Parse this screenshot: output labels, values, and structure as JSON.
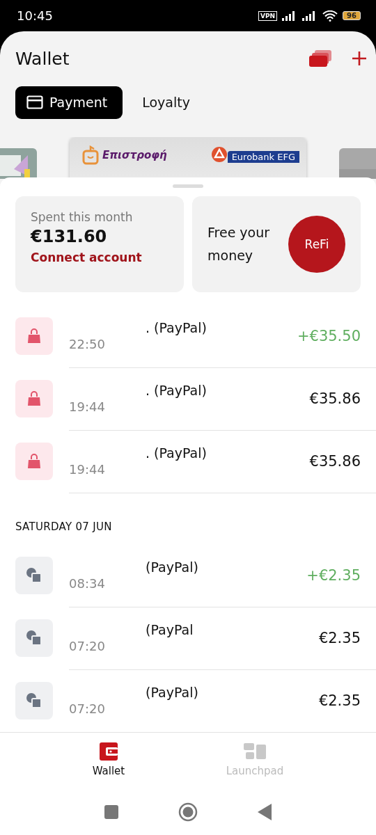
{
  "status_bar": {
    "time": "10:45",
    "vpn": "VPN",
    "battery": "96"
  },
  "header": {
    "title": "Wallet"
  },
  "tabs": [
    {
      "label": "Payment",
      "selected": true
    },
    {
      "label": "Loyalty",
      "selected": false
    }
  ],
  "card": {
    "brand": "Επιστροφή",
    "bank": "Eurobank EFG"
  },
  "summary": {
    "label": "Spent this month",
    "amount": "€131.60",
    "link": "Connect account",
    "promo": "Free your money",
    "promo_button": "ReFi"
  },
  "transactions": [
    {
      "kind": "purchase",
      "name": ". (PayPal)",
      "time": "22:50",
      "amount": "+€35.50",
      "incoming": true
    },
    {
      "kind": "purchase",
      "name": ". (PayPal)",
      "time": "19:44",
      "amount": "€35.86",
      "incoming": false
    },
    {
      "kind": "purchase",
      "name": ". (PayPal)",
      "time": "19:44",
      "amount": "€35.86",
      "incoming": false
    },
    {
      "kind": "date",
      "label": "SATURDAY 07 JUN"
    },
    {
      "kind": "service",
      "name": "(PayPal)",
      "time": "08:34",
      "amount": "+€2.35",
      "incoming": true
    },
    {
      "kind": "service",
      "name": "(PayPal",
      "time": "07:20",
      "amount": "€2.35",
      "incoming": false
    },
    {
      "kind": "service",
      "name": "(PayPal)",
      "time": "07:20",
      "amount": "€2.35",
      "incoming": false
    }
  ],
  "bottom_nav": [
    {
      "label": "Wallet",
      "selected": true
    },
    {
      "label": "Launchpad",
      "selected": false
    }
  ]
}
